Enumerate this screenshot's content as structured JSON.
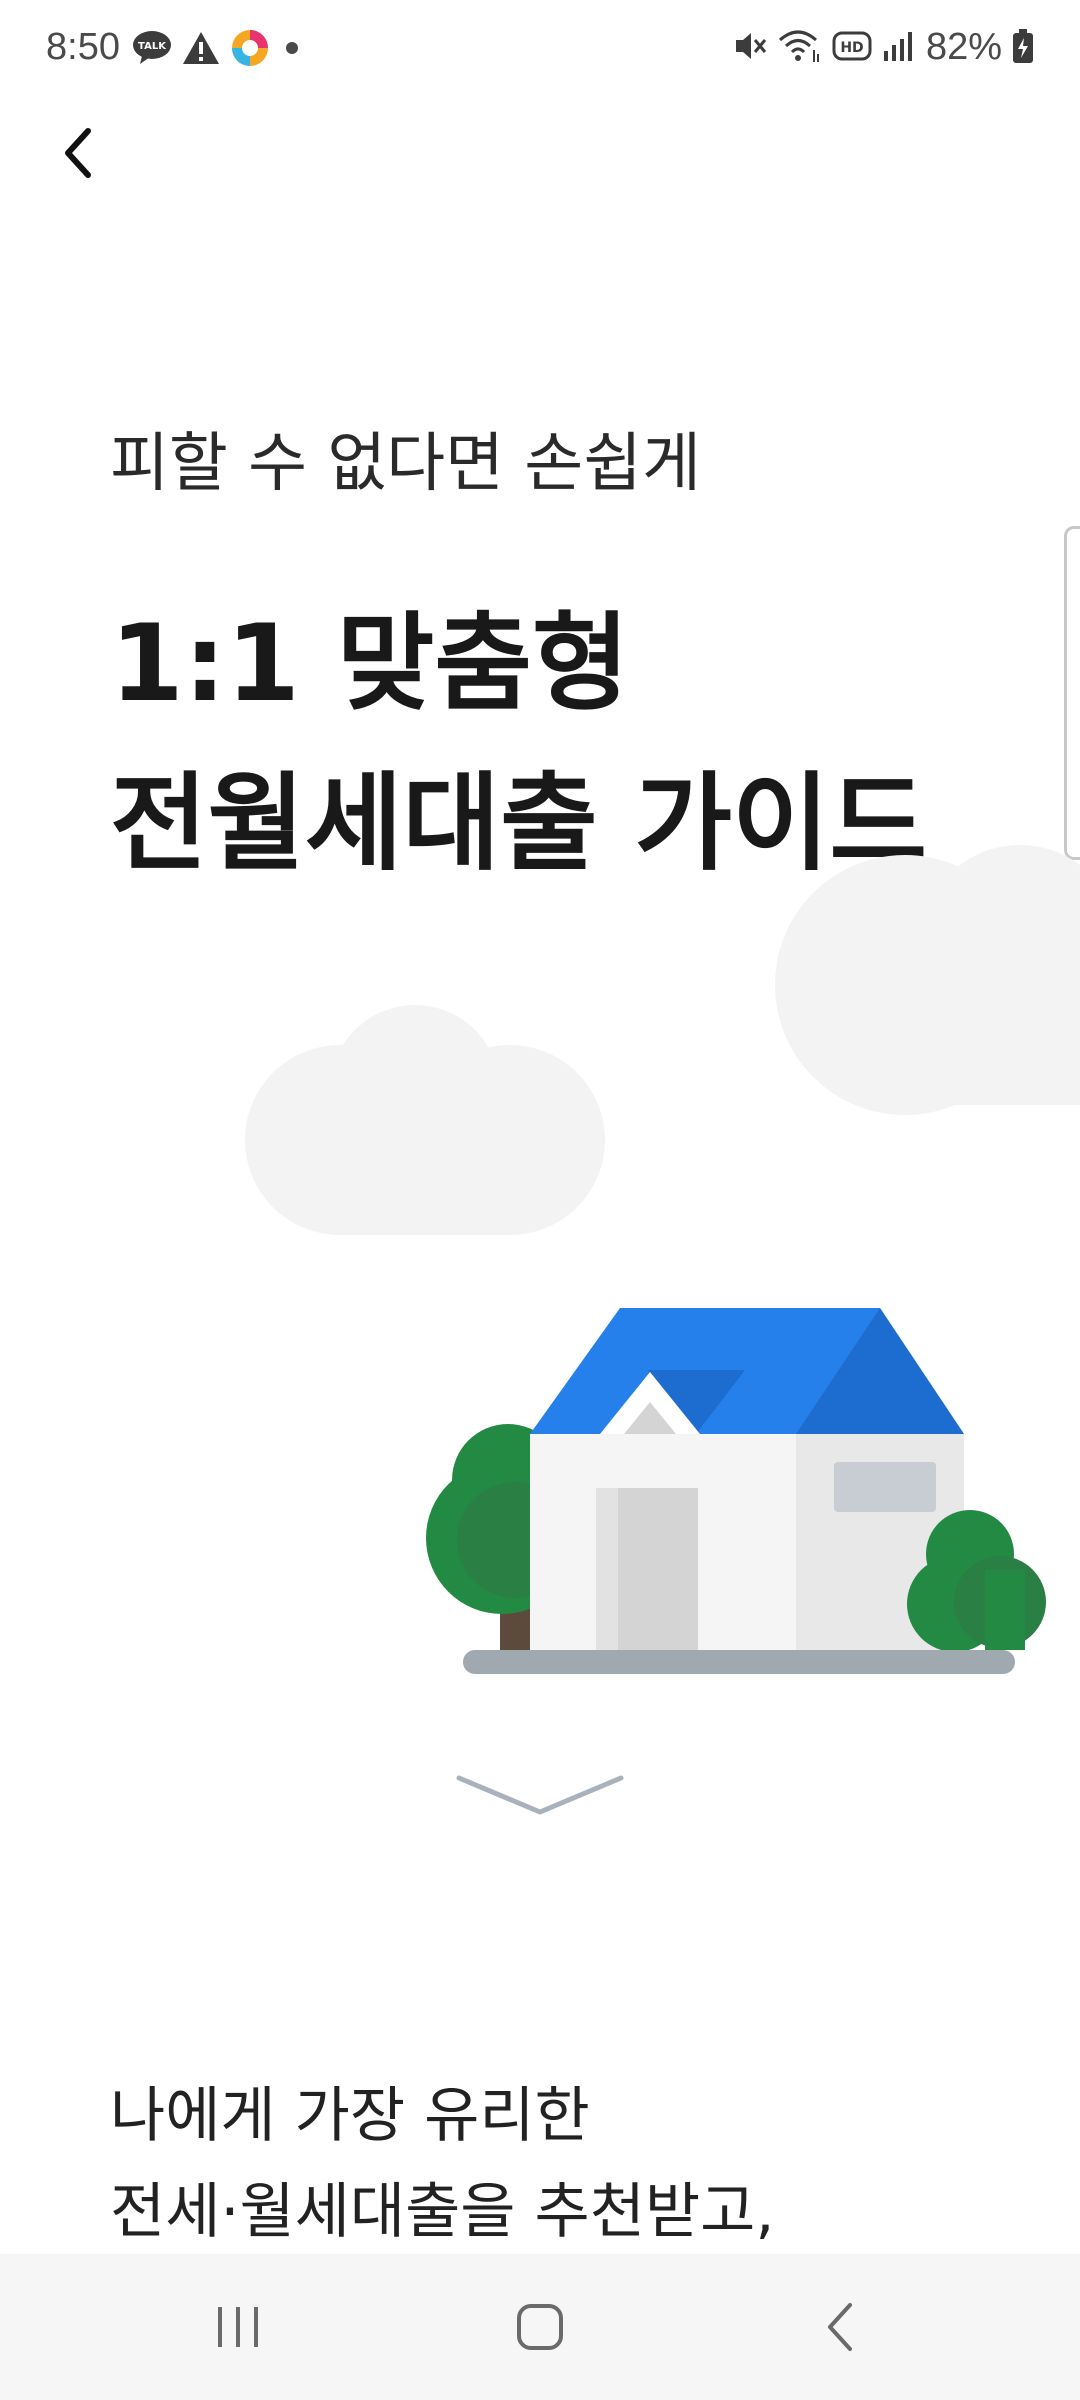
{
  "status_bar": {
    "time": "8:50",
    "battery": "82%",
    "left_icons": [
      "kakaotalk-icon",
      "warning-icon",
      "app-icon",
      "dot-icon"
    ],
    "right_icons": [
      "mute-icon",
      "wifi-icon",
      "hd-icon",
      "signal-icon",
      "battery-icon"
    ]
  },
  "header": {
    "back_icon": "chevron-left-icon"
  },
  "hero": {
    "subtitle": "피할 수 없다면 손쉽게",
    "title_line1": "1:1 맞춤형",
    "title_line2": "전월세대출 가이드"
  },
  "illustration": {
    "name": "house-with-trees-and-clouds",
    "colors": {
      "roof": "#2680EB",
      "roof_dark": "#1D6CCF",
      "wall": "#F5F5F5",
      "wall_side": "#E8E8E8",
      "tree": "#238A43",
      "cloud": "#F3F3F3",
      "ground": "#A0A8B0"
    }
  },
  "scroll_hint_icon": "chevron-down-icon",
  "description": {
    "line1": "나에게 가장 유리한",
    "line2": "전세·월세대출을 추천받고,"
  },
  "nav_bar": {
    "recent_icon": "recent-apps-icon",
    "home_icon": "home-icon",
    "back_icon": "back-icon"
  }
}
